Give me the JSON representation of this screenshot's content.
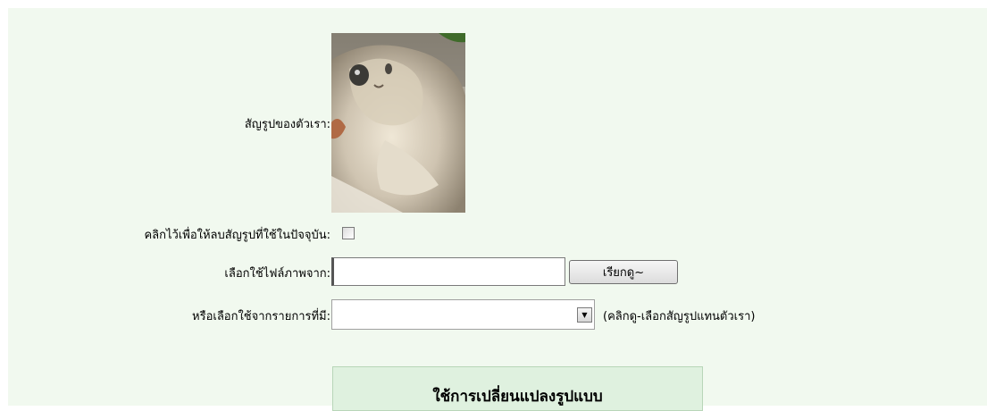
{
  "form": {
    "avatar_label": "สัญรูปของตัวเรา:",
    "delete_label": "คลิกไว้เพื่อให้ลบสัญรูปที่ใช้ในปัจจุบัน:",
    "file_label": "เลือกใช้ไฟล์ภาพจาก:",
    "file_value": "",
    "browse_label": "เรียกดู~",
    "gallery_label": "หรือเลือกใช้จากรายการที่มี:",
    "gallery_selected": "",
    "gallery_hint": "(คลิกดู-เลือกสัญรูปแทนตัวเรา)",
    "submit_label": "ใช้การเปลี่ยนแปลงรูปแบบ"
  },
  "colors": {
    "panel_bg": "#f1f9ef",
    "submit_bg": "#dff1df"
  }
}
